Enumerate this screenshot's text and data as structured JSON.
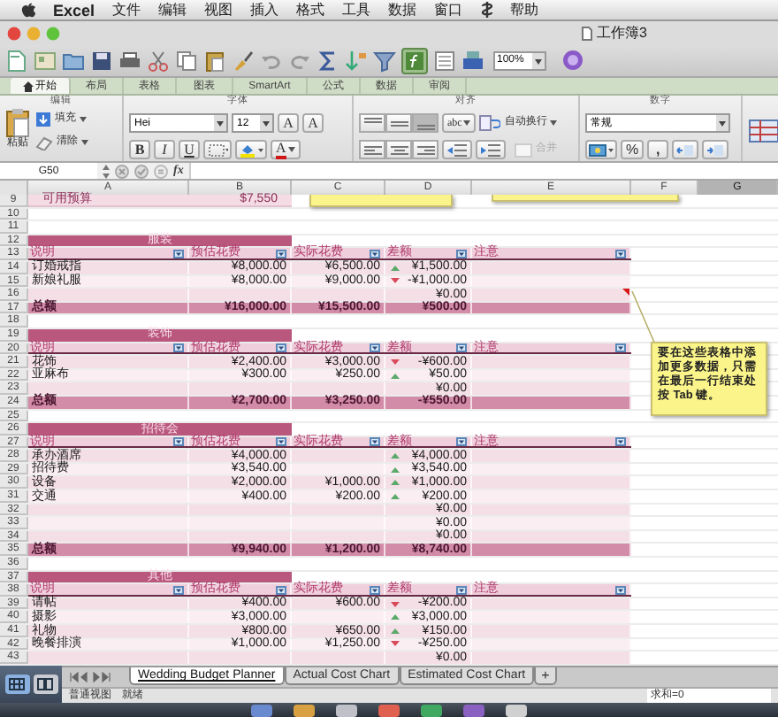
{
  "menu_bar": {
    "app": "Excel",
    "menus": [
      "文件",
      "编辑",
      "视图",
      "插入",
      "格式",
      "工具",
      "数据",
      "窗口"
    ],
    "help": "帮助"
  },
  "window": {
    "title": "工作簿3"
  },
  "toolbar": {
    "zoom": "100%",
    "formula_builder_on": true
  },
  "ribbon": {
    "tabs": [
      {
        "label": "开始",
        "selected": true
      },
      {
        "label": "布局",
        "selected": false
      },
      {
        "label": "表格",
        "selected": false
      },
      {
        "label": "图表",
        "selected": false
      },
      {
        "label": "SmartArt",
        "selected": false
      },
      {
        "label": "公式",
        "selected": false
      },
      {
        "label": "数据",
        "selected": false
      },
      {
        "label": "审阅",
        "selected": false
      }
    ],
    "groups": [
      {
        "title": "编辑"
      },
      {
        "title": "字体"
      },
      {
        "title": "对齐"
      },
      {
        "title": "数字"
      }
    ],
    "paste_label": "粘贴",
    "fill_label": "填充",
    "clear_label": "清除",
    "font_name": "Hei",
    "font_size": "12",
    "grow_font": "A",
    "shrink_font": "A",
    "bold": "B",
    "italic": "I",
    "underline": "U",
    "font_color": "A",
    "vertical_align": [
      {
        "selected": false
      },
      {
        "selected": false
      },
      {
        "selected": true
      }
    ],
    "orientation": "abc",
    "wrap_label": "自动换行",
    "merge": {
      "label": "合并",
      "disabled": true
    },
    "number_format": "常规",
    "percent": "%",
    "comma": ","
  },
  "formula_bar": {
    "cell": "G50",
    "function_label": "fx"
  },
  "columns": [
    {
      "label": "A",
      "selected": false
    },
    {
      "label": "B",
      "selected": false
    },
    {
      "label": "C",
      "selected": false
    },
    {
      "label": "D",
      "selected": false
    },
    {
      "label": "E",
      "selected": false
    },
    {
      "label": "F",
      "selected": false
    },
    {
      "label": "G",
      "selected": true
    }
  ],
  "rows": [
    {
      "number": "9",
      "kind": "budget",
      "label": "可用预算",
      "value": "$7,550"
    },
    {
      "number": "10",
      "kind": "blank"
    },
    {
      "number": "11",
      "kind": "blank"
    },
    {
      "number": "12",
      "kind": "section",
      "title": "服装"
    },
    {
      "number": "13",
      "kind": "header",
      "columns": [
        "说明",
        "预估花费",
        "实际花费",
        "差额",
        "注意"
      ]
    },
    {
      "number": "14",
      "kind": "item",
      "description": "订婚戒指",
      "estimated": "¥8,000.00",
      "actual": "¥6,500.00",
      "difference": "¥1,500.00",
      "increase": true,
      "comment": false
    },
    {
      "number": "15",
      "kind": "item",
      "description": "新娘礼服",
      "estimated": "¥8,000.00",
      "actual": "¥9,000.00",
      "difference": "-¥1,000.00",
      "increase": false,
      "comment": false
    },
    {
      "number": "16",
      "kind": "item",
      "difference": "¥0.00",
      "comment": true
    },
    {
      "number": "17",
      "kind": "total",
      "description": "总额",
      "estimated": "¥16,000.00",
      "actual": "¥15,500.00",
      "difference": "¥500.00"
    },
    {
      "number": "18",
      "kind": "blank"
    },
    {
      "number": "19",
      "kind": "section",
      "title": "装饰"
    },
    {
      "number": "20",
      "kind": "header",
      "columns": [
        "说明",
        "预估花费",
        "实际花费",
        "差额",
        "注意"
      ]
    },
    {
      "number": "21",
      "kind": "item",
      "description": "花饰",
      "estimated": "¥2,400.00",
      "actual": "¥3,000.00",
      "difference": "-¥600.00",
      "increase": false,
      "comment": false
    },
    {
      "number": "22",
      "kind": "item",
      "description": "亚麻布",
      "estimated": "¥300.00",
      "actual": "¥250.00",
      "difference": "¥50.00",
      "increase": true,
      "comment": false
    },
    {
      "number": "23",
      "kind": "item",
      "difference": "¥0.00",
      "comment": false
    },
    {
      "number": "24",
      "kind": "total",
      "description": "总额",
      "estimated": "¥2,700.00",
      "actual": "¥3,250.00",
      "difference": "-¥550.00"
    },
    {
      "number": "25",
      "kind": "blank"
    },
    {
      "number": "26",
      "kind": "section",
      "title": "招待会"
    },
    {
      "number": "27",
      "kind": "header",
      "columns": [
        "说明",
        "预估花费",
        "实际花费",
        "差额",
        "注意"
      ]
    },
    {
      "number": "28",
      "kind": "item",
      "description": "承办酒席",
      "estimated": "¥4,000.00",
      "difference": "¥4,000.00",
      "increase": true,
      "comment": false
    },
    {
      "number": "29",
      "kind": "item",
      "description": "招待费",
      "estimated": "¥3,540.00",
      "difference": "¥3,540.00",
      "increase": true,
      "comment": false
    },
    {
      "number": "30",
      "kind": "item",
      "description": "设备",
      "estimated": "¥2,000.00",
      "actual": "¥1,000.00",
      "difference": "¥1,000.00",
      "increase": true,
      "comment": false
    },
    {
      "number": "31",
      "kind": "item",
      "description": "交通",
      "estimated": "¥400.00",
      "actual": "¥200.00",
      "difference": "¥200.00",
      "increase": true,
      "comment": false
    },
    {
      "number": "32",
      "kind": "item",
      "difference": "¥0.00",
      "comment": false
    },
    {
      "number": "33",
      "kind": "item",
      "difference": "¥0.00",
      "comment": false
    },
    {
      "number": "34",
      "kind": "item",
      "difference": "¥0.00",
      "comment": false
    },
    {
      "number": "35",
      "kind": "total",
      "description": "总额",
      "estimated": "¥9,940.00",
      "actual": "¥1,200.00",
      "difference": "¥8,740.00"
    },
    {
      "number": "36",
      "kind": "blank"
    },
    {
      "number": "37",
      "kind": "section",
      "title": "其他"
    },
    {
      "number": "38",
      "kind": "header",
      "columns": [
        "说明",
        "预估花费",
        "实际花费",
        "差额",
        "注意"
      ]
    },
    {
      "number": "39",
      "kind": "item",
      "description": "请帖",
      "estimated": "¥400.00",
      "actual": "¥600.00",
      "difference": "-¥200.00",
      "increase": false,
      "comment": false
    },
    {
      "number": "40",
      "kind": "item",
      "description": "摄影",
      "estimated": "¥3,000.00",
      "difference": "¥3,000.00",
      "increase": true,
      "comment": false
    },
    {
      "number": "41",
      "kind": "item",
      "description": "礼物",
      "estimated": "¥800.00",
      "actual": "¥650.00",
      "difference": "¥150.00",
      "increase": true,
      "comment": false
    },
    {
      "number": "42",
      "kind": "item",
      "description": "晚餐排演",
      "estimated": "¥1,000.00",
      "actual": "¥1,250.00",
      "difference": "-¥250.00",
      "increase": false,
      "comment": false
    },
    {
      "number": "43",
      "kind": "item",
      "difference": "¥0.00",
      "comment": false
    }
  ],
  "comment_note": {
    "text": "要在这些表格中添加更多数据，只需在最后一行结束处按 Tab 键。"
  },
  "view_buttons": [
    {
      "selected": true
    },
    {
      "selected": false
    }
  ],
  "sheet_tabs": [
    {
      "label": "Wedding Budget Planner",
      "selected": true
    },
    {
      "label": "Actual Cost Chart",
      "selected": false
    },
    {
      "label": "Estimated Cost Chart",
      "selected": false
    }
  ],
  "new_sheet": "+",
  "status_bar": {
    "view": "普通视图",
    "mode": "就绪",
    "sum": "求和=0"
  }
}
